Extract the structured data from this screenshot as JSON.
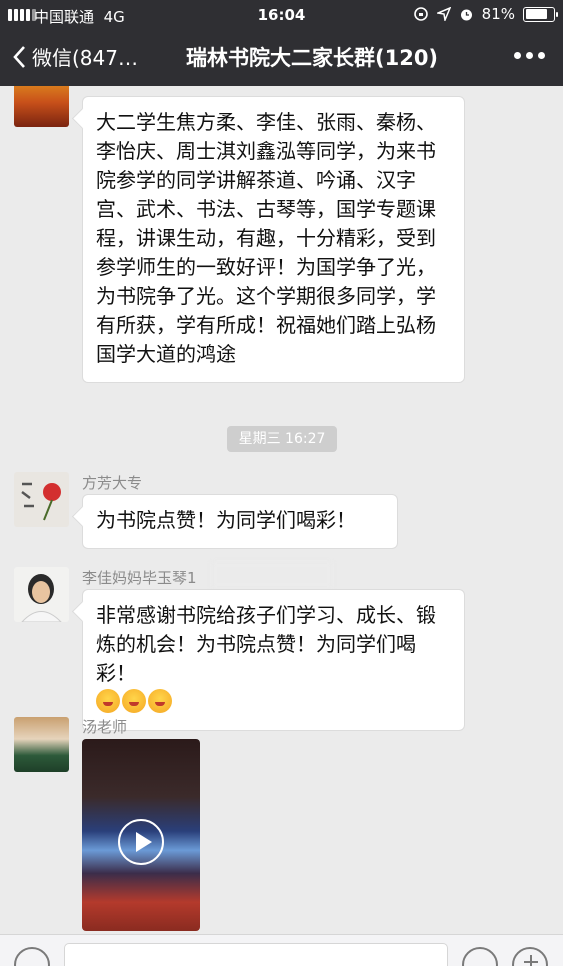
{
  "status_bar": {
    "carrier": "中国联通",
    "network": "4G",
    "time": "16:04",
    "battery": "81%",
    "battery_level": 0.81
  },
  "nav": {
    "back_label": "微信(847…",
    "title": "瑞林书院大二家长群(120)"
  },
  "messages": [
    {
      "text": "大二学生焦方柔、李佳、张雨、秦杨、李怡庆、周士淇刘鑫泓等同学，为来书院参学的同学讲解茶道、吟诵、汉字宫、武术、书法、古琴等，国学专题课程，讲课生动，有趣，十分精彩，受到参学师生的一致好评！为国学争了光，为书院争了光。这个学期很多同学，学有所获，学有所成！祝福她们踏上弘杨国学大道的鸿途"
    },
    {
      "sender": "方芳大专",
      "text": "为书院点赞！为同学们喝彩！"
    },
    {
      "sender": "李佳妈妈毕玉琴1",
      "text": "非常感谢书院给孩子们学习、成长、锻炼的机会！为书院点赞！为同学们喝彩！"
    },
    {
      "sender": "汤老师"
    }
  ],
  "timestamp": "星期三 16:27",
  "colors": {
    "bar": "#2f2f33",
    "chat_bg": "#ebebeb",
    "bubble": "#ffffff",
    "timestamp_bg": "#cecece"
  }
}
